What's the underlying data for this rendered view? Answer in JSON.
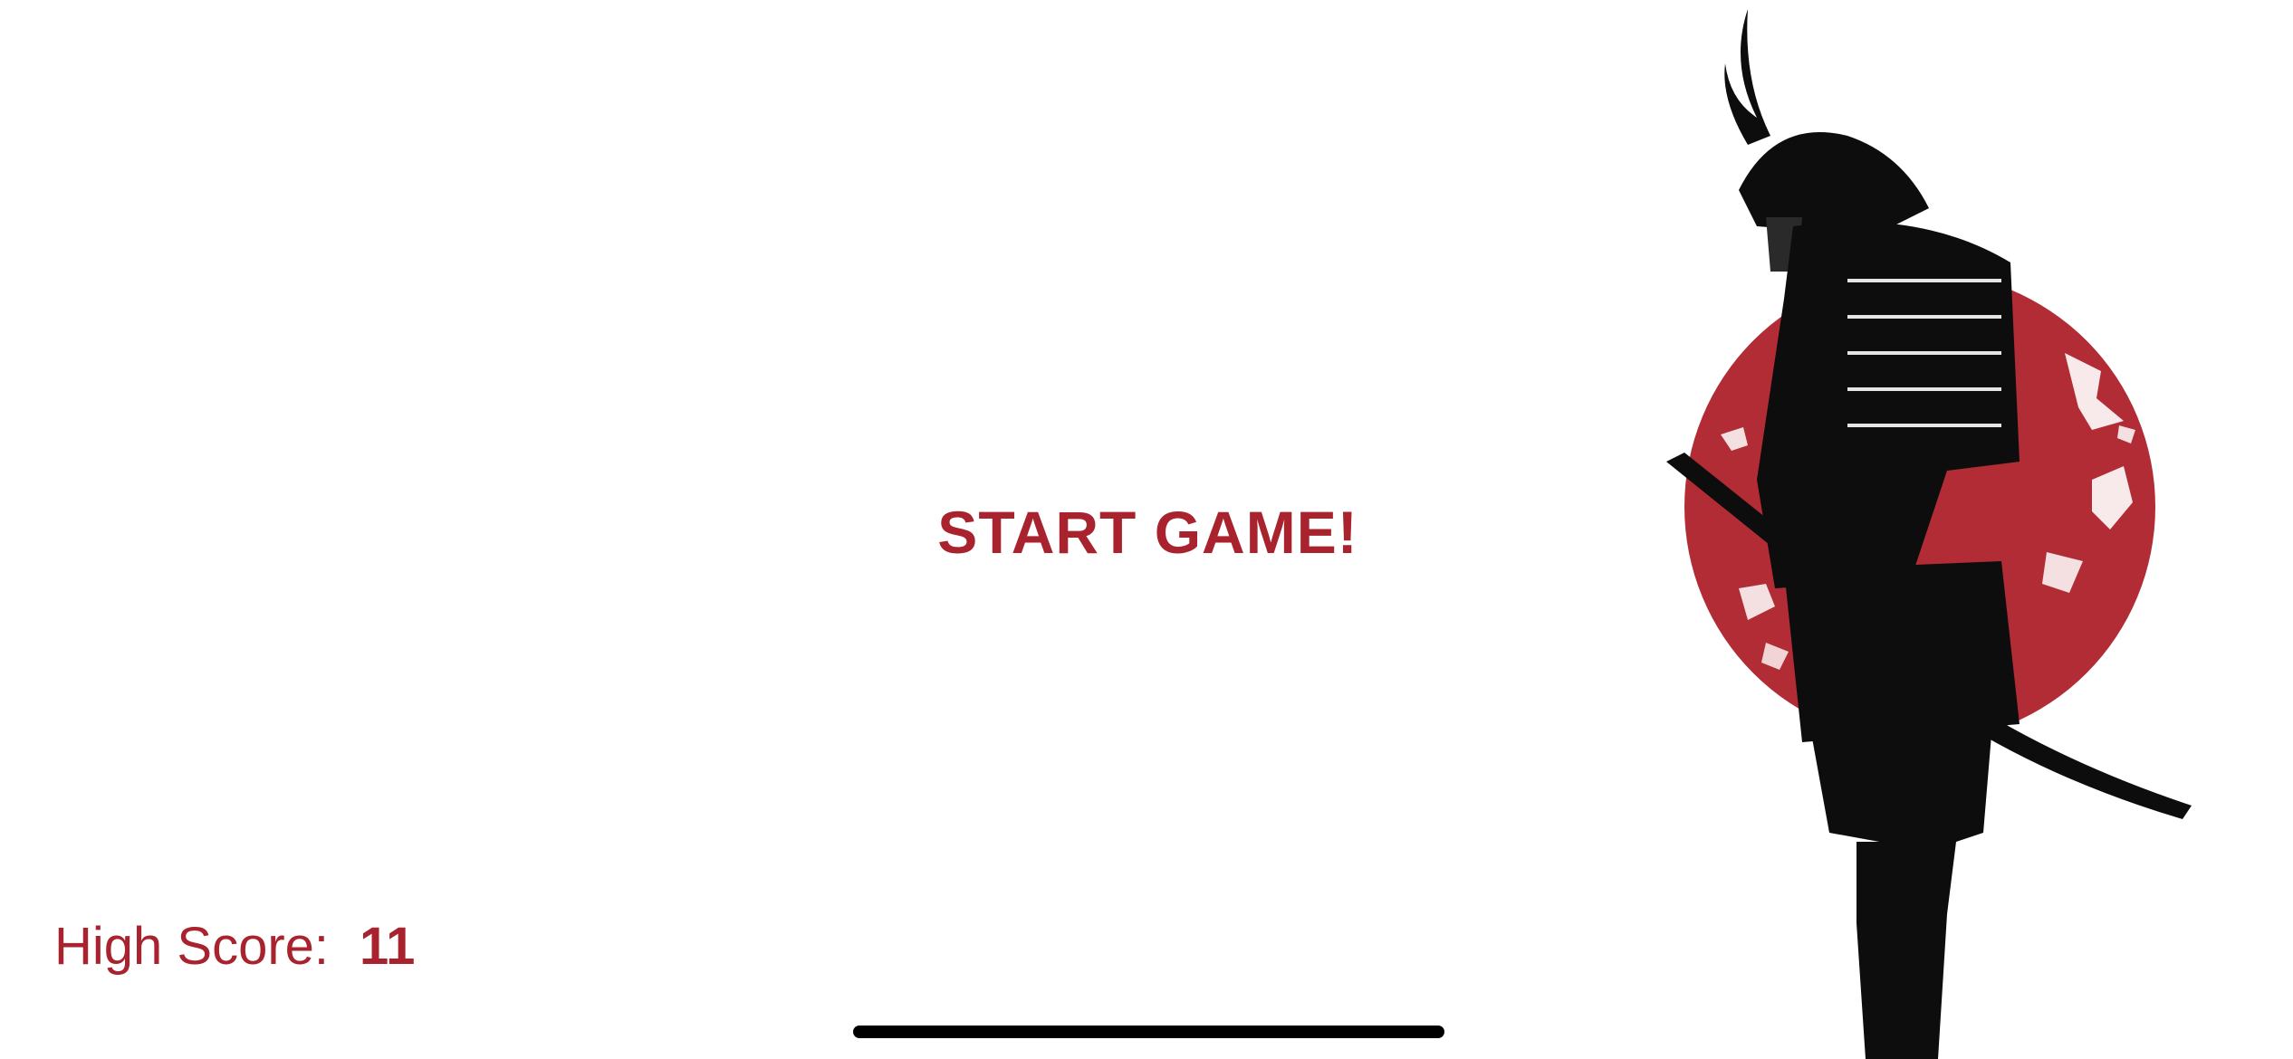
{
  "menu": {
    "start_label": "START GAME!"
  },
  "high_score": {
    "label": "High Score:",
    "value": "11"
  },
  "artwork": {
    "subject": "samurai-warrior",
    "accent_color": "#a8232e",
    "sun_color": "#b22c35"
  }
}
